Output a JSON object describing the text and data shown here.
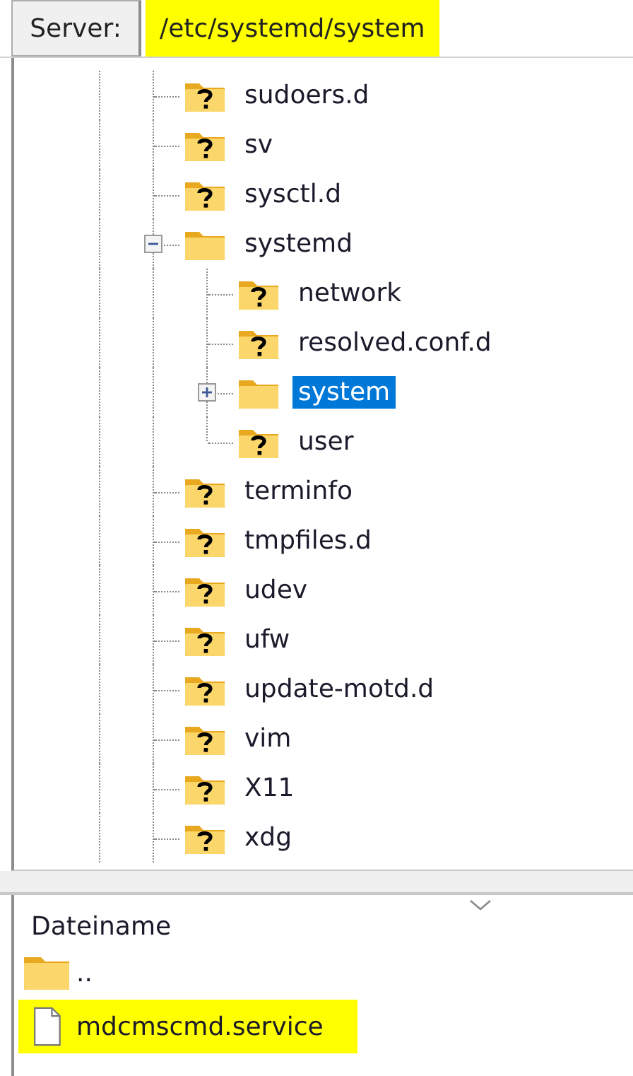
{
  "server_bar": {
    "label": "Server:",
    "path": "/etc/systemd/system",
    "highlighted": true
  },
  "tree": {
    "items": [
      {
        "name": "sudoers.d",
        "unknown": true,
        "selected": false
      },
      {
        "name": "sv",
        "unknown": true,
        "selected": false
      },
      {
        "name": "sysctl.d",
        "unknown": true,
        "selected": false
      },
      {
        "name": "systemd",
        "unknown": false,
        "selected": false,
        "expanded": true,
        "children": [
          {
            "name": "network",
            "unknown": true,
            "selected": false
          },
          {
            "name": "resolved.conf.d",
            "unknown": true,
            "selected": false
          },
          {
            "name": "system",
            "unknown": false,
            "selected": true,
            "expanded": false
          },
          {
            "name": "user",
            "unknown": true,
            "selected": false
          }
        ]
      },
      {
        "name": "terminfo",
        "unknown": true,
        "selected": false
      },
      {
        "name": "tmpfiles.d",
        "unknown": true,
        "selected": false
      },
      {
        "name": "udev",
        "unknown": true,
        "selected": false
      },
      {
        "name": "ufw",
        "unknown": true,
        "selected": false
      },
      {
        "name": "update-motd.d",
        "unknown": true,
        "selected": false
      },
      {
        "name": "vim",
        "unknown": true,
        "selected": false
      },
      {
        "name": "X11",
        "unknown": true,
        "selected": false
      },
      {
        "name": "xdg",
        "unknown": true,
        "selected": false
      }
    ]
  },
  "file_list": {
    "column": "Dateiname",
    "rows": [
      {
        "kind": "folder",
        "name": "..",
        "highlighted": false
      },
      {
        "kind": "file",
        "name": "mdcmscmd.service",
        "highlighted": true
      }
    ]
  }
}
